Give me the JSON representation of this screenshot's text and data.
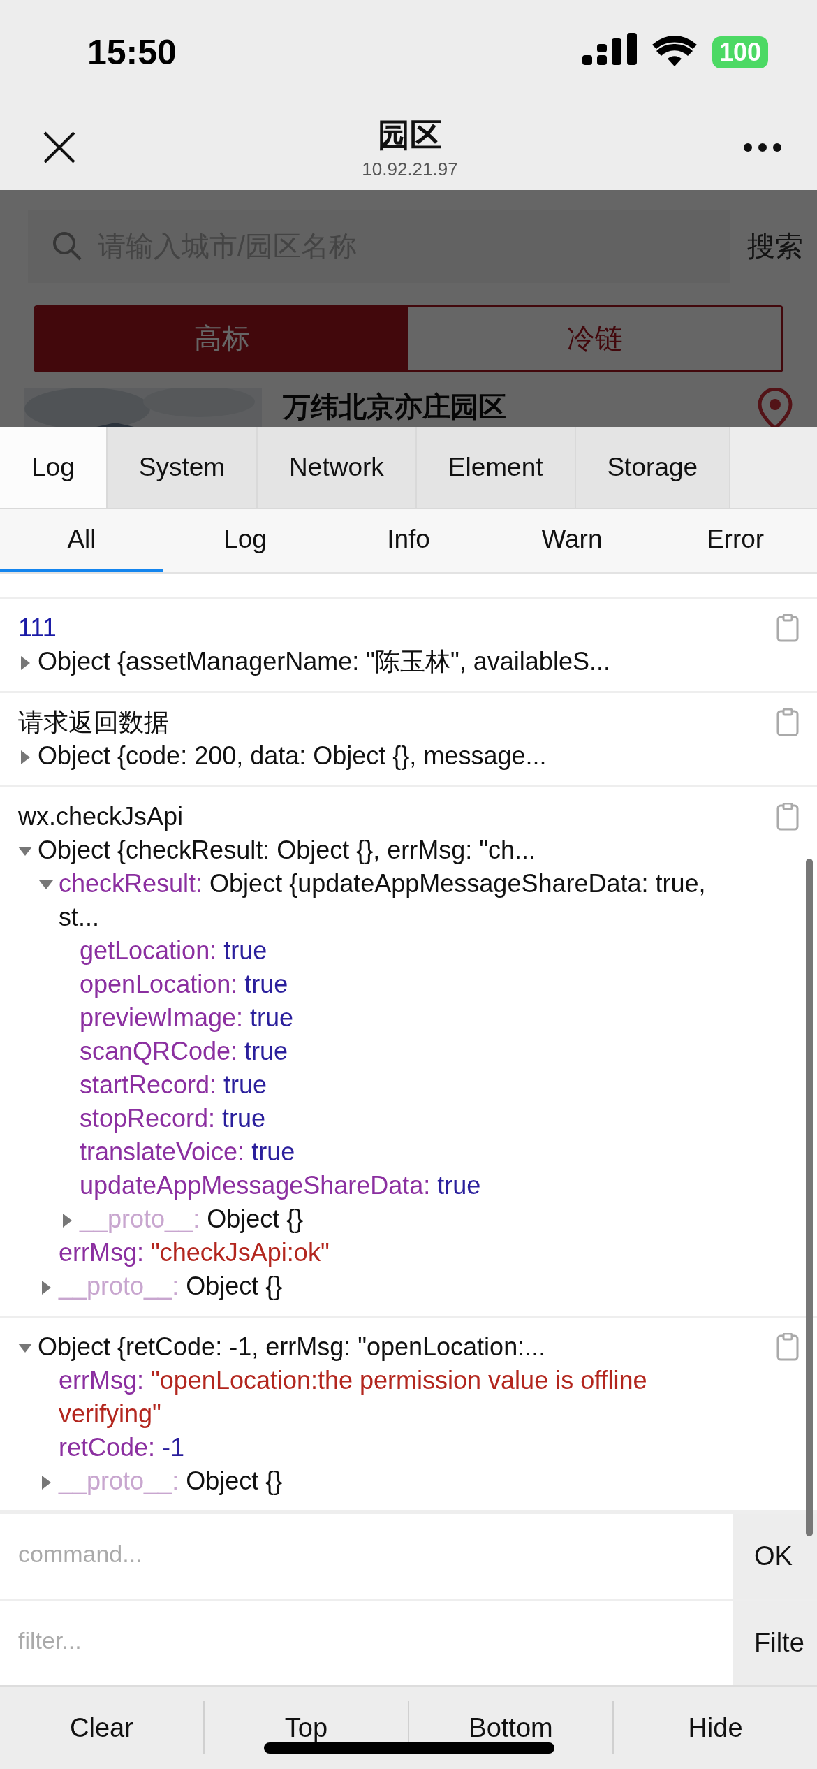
{
  "status_bar": {
    "time": "15:50",
    "battery": "100"
  },
  "nav_bar": {
    "title": "园区",
    "subtitle": "10.92.21.97"
  },
  "page": {
    "search": {
      "placeholder": "请输入城市/园区名称",
      "button": "搜索"
    },
    "segments": [
      {
        "label": "高标",
        "selected": true
      },
      {
        "label": "冷链",
        "selected": false
      }
    ],
    "list": [
      {
        "kind": "picture",
        "title": "万纬北京亦庄园区"
      }
    ]
  },
  "console": {
    "tabs": [
      {
        "label": "Log",
        "selected": true
      },
      {
        "label": "System",
        "selected": false
      },
      {
        "label": "Network",
        "selected": false
      },
      {
        "label": "Element",
        "selected": false
      },
      {
        "label": "Storage",
        "selected": false
      }
    ],
    "filters": [
      {
        "label": "All",
        "selected": true
      },
      {
        "label": "Log",
        "selected": false
      },
      {
        "label": "Info",
        "selected": false
      },
      {
        "label": "Warn",
        "selected": false
      },
      {
        "label": "Error",
        "selected": false
      }
    ],
    "logs": [
      {
        "label": {
          "text": "111",
          "kind": "number"
        },
        "tree": {
          "value": "Object {assetManagerName: \"陈玉林\", availableS...",
          "kind": "object",
          "expanded": false
        }
      },
      {
        "label": {
          "text": "请求返回数据",
          "kind": "text"
        },
        "tree": {
          "value": "Object {code: 200, data: Object {}, message...",
          "kind": "object",
          "expanded": false
        }
      },
      {
        "label": {
          "text": "wx.checkJsApi",
          "kind": "text"
        },
        "tree": {
          "value": "Object {checkResult: Object {}, errMsg: \"ch...",
          "kind": "object",
          "expanded": true,
          "children": [
            {
              "key": "checkResult:",
              "value": "Object {updateAppMessageShareData: true, st...",
              "kind": "object",
              "expanded": true,
              "children": [
                {
                  "key": "getLocation:",
                  "value": "true",
                  "kind": "boolean"
                },
                {
                  "key": "openLocation:",
                  "value": "true",
                  "kind": "boolean"
                },
                {
                  "key": "previewImage:",
                  "value": "true",
                  "kind": "boolean"
                },
                {
                  "key": "scanQRCode:",
                  "value": "true",
                  "kind": "boolean"
                },
                {
                  "key": "startRecord:",
                  "value": "true",
                  "kind": "boolean"
                },
                {
                  "key": "stopRecord:",
                  "value": "true",
                  "kind": "boolean"
                },
                {
                  "key": "translateVoice:",
                  "value": "true",
                  "kind": "boolean"
                },
                {
                  "key": "updateAppMessageShareData:",
                  "value": "true",
                  "kind": "boolean"
                },
                {
                  "key": "__proto__:",
                  "value": "Object {}",
                  "kind": "proto",
                  "expanded": false
                }
              ]
            },
            {
              "key": "errMsg:",
              "value": "\"checkJsApi:ok\"",
              "kind": "string"
            },
            {
              "key": "__proto__:",
              "value": "Object {}",
              "kind": "proto",
              "expanded": false
            }
          ]
        }
      },
      {
        "tree": {
          "value": "Object {retCode: -1, errMsg: \"openLocation:...",
          "kind": "object",
          "expanded": true,
          "children": [
            {
              "key": "errMsg:",
              "value": "\"openLocation:the permission value is offline verifying\"",
              "kind": "string"
            },
            {
              "key": "retCode:",
              "value": "-1",
              "kind": "number"
            },
            {
              "key": "__proto__:",
              "value": "Object {}",
              "kind": "proto",
              "expanded": false
            }
          ]
        }
      }
    ],
    "command": {
      "placeholder": "command...",
      "button": "OK"
    },
    "filter": {
      "placeholder": "filter...",
      "button": "Filte"
    },
    "toolbar": [
      "Clear",
      "Top",
      "Bottom",
      "Hide"
    ]
  }
}
